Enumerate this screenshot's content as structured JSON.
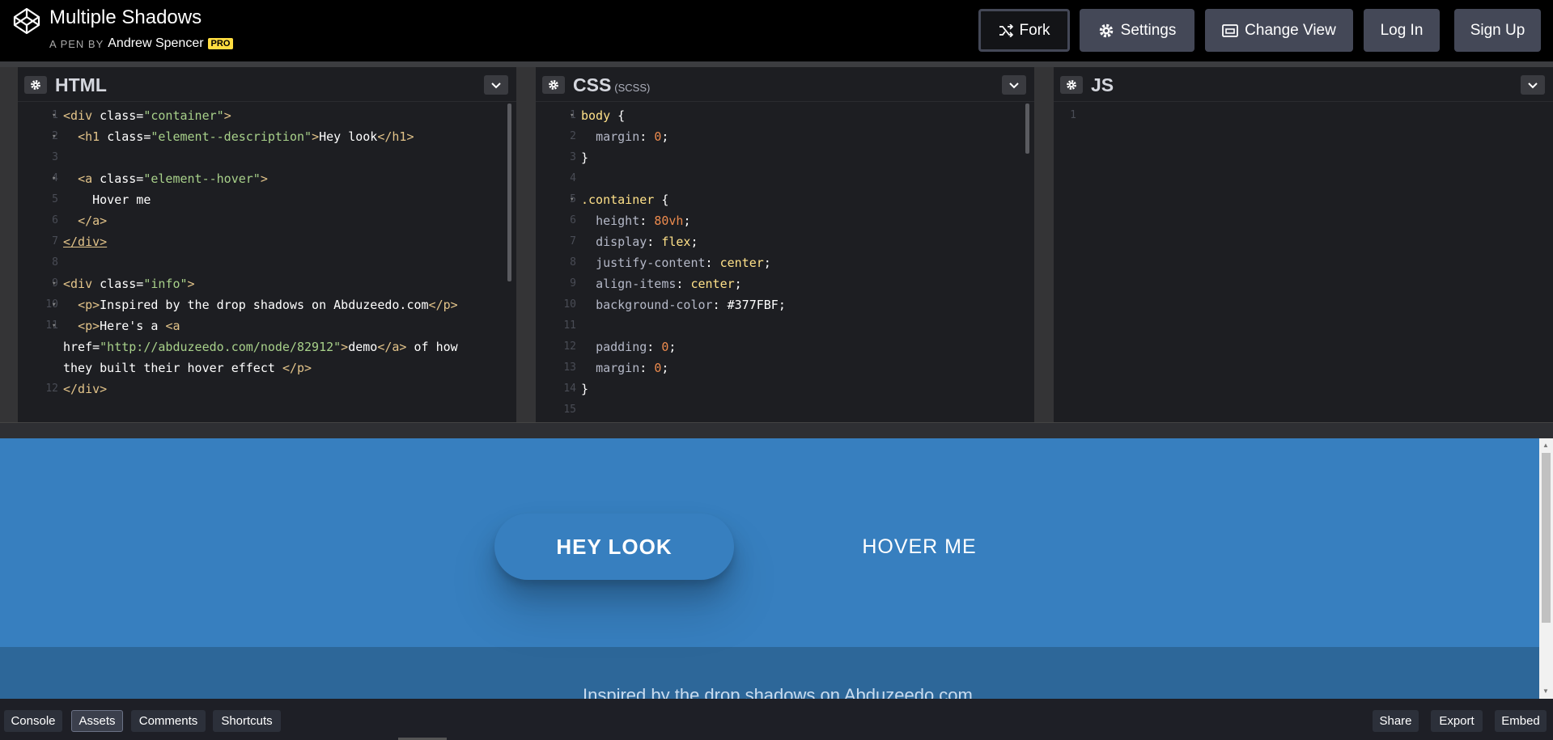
{
  "header": {
    "title": "Multiple Shadows",
    "byline_prefix": "A PEN BY",
    "author": "Andrew Spencer",
    "badge": "PRO",
    "buttons": {
      "fork": "Fork",
      "settings": "Settings",
      "change_view": "Change View",
      "login": "Log In",
      "signup": "Sign Up"
    }
  },
  "editors": {
    "html": {
      "title": "HTML"
    },
    "css": {
      "title": "CSS",
      "subtitle": "(SCSS)"
    },
    "js": {
      "title": "JS",
      "line": "1"
    }
  },
  "preview": {
    "hey_look": "HEY LOOK",
    "hover_me": "HOVER ME",
    "info_text": "Inspired by the drop shadows on Abduzeedo.com",
    "background_color": "#377FBF"
  },
  "footer": {
    "console": "Console",
    "assets": "Assets",
    "comments": "Comments",
    "shortcuts": "Shortcuts",
    "share": "Share",
    "export": "Export",
    "embed": "Embed"
  }
}
